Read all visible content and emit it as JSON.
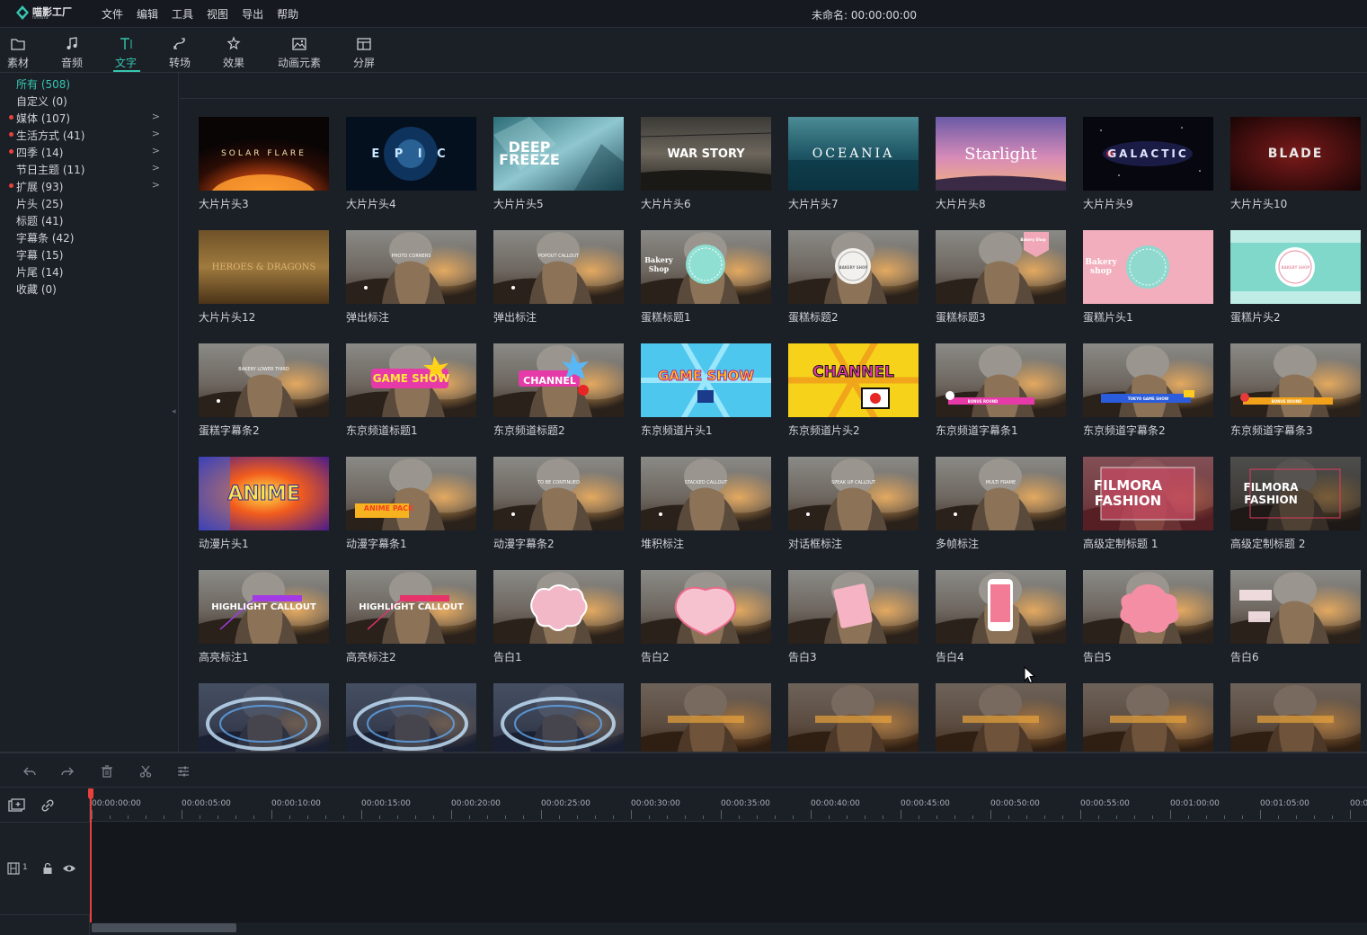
{
  "app": {
    "logo_name": "喵影工厂",
    "logo_sub": "filmora",
    "menu": [
      "文件",
      "编辑",
      "工具",
      "视图",
      "导出",
      "帮助"
    ],
    "project_title": "未命名: 00:00:00:00"
  },
  "tabs": [
    {
      "label": "素材",
      "icon": "folder-icon"
    },
    {
      "label": "音频",
      "icon": "music-note-icon"
    },
    {
      "label": "文字",
      "icon": "text-icon",
      "active": true
    },
    {
      "label": "转场",
      "icon": "transition-icon"
    },
    {
      "label": "效果",
      "icon": "effects-icon"
    },
    {
      "label": "动画元素",
      "icon": "image-icon"
    },
    {
      "label": "分屏",
      "icon": "split-screen-icon"
    }
  ],
  "categories": [
    {
      "label": "所有 (508)",
      "active": true,
      "dot": false,
      "arrow": false
    },
    {
      "label": "自定义 (0)",
      "dot": false,
      "arrow": false
    },
    {
      "label": "媒体 (107)",
      "dot": true,
      "arrow": true
    },
    {
      "label": "生活方式 (41)",
      "dot": true,
      "arrow": true
    },
    {
      "label": "四季 (14)",
      "dot": true,
      "arrow": true
    },
    {
      "label": "节日主题 (11)",
      "dot": false,
      "arrow": true
    },
    {
      "label": "扩展 (93)",
      "dot": true,
      "arrow": true
    },
    {
      "label": "片头 (25)",
      "dot": false,
      "arrow": false
    },
    {
      "label": "标题 (41)",
      "dot": false,
      "arrow": false
    },
    {
      "label": "字幕条 (42)",
      "dot": false,
      "arrow": false
    },
    {
      "label": "字幕 (15)",
      "dot": false,
      "arrow": false
    },
    {
      "label": "片尾 (14)",
      "dot": false,
      "arrow": false
    },
    {
      "label": "收藏 (0)",
      "dot": false,
      "arrow": false
    }
  ],
  "colors": {
    "accent": "#36c6b1",
    "dot": "#e8413c",
    "playhead": "#e8413c"
  },
  "items": [
    {
      "label": "大片片头3",
      "thumb_text": "SOLAR FLARE",
      "style": "solar"
    },
    {
      "label": "大片片头4",
      "thumb_text": "E P I C",
      "style": "epic"
    },
    {
      "label": "大片片头5",
      "thumb_text": "DEEP FREEZE",
      "style": "freeze"
    },
    {
      "label": "大片片头6",
      "thumb_text": "WAR STORY",
      "style": "war"
    },
    {
      "label": "大片片头7",
      "thumb_text": "OCEANIA",
      "style": "ocean"
    },
    {
      "label": "大片片头8",
      "thumb_text": "Starlight",
      "style": "star"
    },
    {
      "label": "大片片头9",
      "thumb_text": "GALACTIC",
      "style": "galactic"
    },
    {
      "label": "大片片头10",
      "thumb_text": "BLADE",
      "style": "blade"
    },
    {
      "label": "大片片头12",
      "thumb_text": "HEROES & DRAGONS",
      "style": "heroes"
    },
    {
      "label": "弹出标注",
      "thumb_text": "PHOTO CORNERS",
      "style": "photo"
    },
    {
      "label": "弹出标注",
      "thumb_text": "POPOUT CALLOUT",
      "style": "photo"
    },
    {
      "label": "蛋糕标题1",
      "thumb_text": "Bakery Shop",
      "style": "bakery-teal"
    },
    {
      "label": "蛋糕标题2",
      "thumb_text": "BAKERY SHOP",
      "style": "bakery-white"
    },
    {
      "label": "蛋糕标题3",
      "thumb_text": "Bakery Shop",
      "style": "bakery-tag"
    },
    {
      "label": "蛋糕片头1",
      "thumb_text": "Bakery shop",
      "style": "bakery-pink"
    },
    {
      "label": "蛋糕片头2",
      "thumb_text": "BAKERY SHOP",
      "style": "bakery-mint"
    },
    {
      "label": "蛋糕字幕条2",
      "thumb_text": "BAKERY LOWER THIRD",
      "style": "photo"
    },
    {
      "label": "东京频道标题1",
      "thumb_text": "GAME SHOW",
      "style": "game-photo"
    },
    {
      "label": "东京频道标题2",
      "thumb_text": "CHANNEL",
      "style": "channel-photo"
    },
    {
      "label": "东京频道片头1",
      "thumb_text": "GAME SHOW",
      "style": "game-blue"
    },
    {
      "label": "东京频道片头2",
      "thumb_text": "CHANNEL",
      "style": "channel-yellow"
    },
    {
      "label": "东京频道字幕条1",
      "thumb_text": "BONUS ROUND",
      "style": "lower-pink"
    },
    {
      "label": "东京频道字幕条2",
      "thumb_text": "TOKYO GAME SHOW",
      "style": "lower-blue"
    },
    {
      "label": "东京频道字幕条3",
      "thumb_text": "BONUS ROUND",
      "style": "lower-orange"
    },
    {
      "label": "动漫片头1",
      "thumb_text": "ANIME",
      "style": "anime"
    },
    {
      "label": "动漫字幕条1",
      "thumb_text": "ANIME PACK",
      "style": "anime-photo"
    },
    {
      "label": "动漫字幕条2",
      "thumb_text": "TO BE CONTINUED",
      "style": "photo"
    },
    {
      "label": "堆积标注",
      "thumb_text": "STACKED CALLOUT",
      "style": "photo"
    },
    {
      "label": "对话框标注",
      "thumb_text": "SPEAK UP CALLOUT",
      "style": "photo"
    },
    {
      "label": "多帧标注",
      "thumb_text": "MULTI FRAME",
      "style": "photo"
    },
    {
      "label": "高级定制标题 1",
      "thumb_text": "FILMORA FASHION",
      "style": "fashion-red"
    },
    {
      "label": "高级定制标题 2",
      "thumb_text": "FILMORA FASHION",
      "style": "fashion-dark"
    },
    {
      "label": "高亮标注1",
      "thumb_text": "HIGHLIGHT CALLOUT",
      "style": "hl-purple"
    },
    {
      "label": "高亮标注2",
      "thumb_text": "HIGHLIGHT CALLOUT",
      "style": "hl-red"
    },
    {
      "label": "告白1",
      "thumb_text": "",
      "style": "love1"
    },
    {
      "label": "告白2",
      "thumb_text": "",
      "style": "love2"
    },
    {
      "label": "告白3",
      "thumb_text": "",
      "style": "love3"
    },
    {
      "label": "告白4",
      "thumb_text": "",
      "style": "love4"
    },
    {
      "label": "告白5",
      "thumb_text": "",
      "style": "love5"
    },
    {
      "label": "告白6",
      "thumb_text": "",
      "style": "love6"
    },
    {
      "label": "",
      "thumb_text": "",
      "style": "swirl"
    },
    {
      "label": "",
      "thumb_text": "",
      "style": "swirl"
    },
    {
      "label": "",
      "thumb_text": "",
      "style": "swirl"
    },
    {
      "label": "",
      "thumb_text": "",
      "style": "gold"
    },
    {
      "label": "",
      "thumb_text": "",
      "style": "gold"
    },
    {
      "label": "",
      "thumb_text": "",
      "style": "gold"
    },
    {
      "label": "",
      "thumb_text": "",
      "style": "gold"
    },
    {
      "label": "",
      "thumb_text": "",
      "style": "gold"
    }
  ],
  "edit_tools": [
    "undo-icon",
    "redo-icon",
    "delete-icon",
    "cut-icon",
    "adjust-icon"
  ],
  "timeline": {
    "ticks": [
      "00:00:00:00",
      "00:00:05:00",
      "00:00:10:00",
      "00:00:15:00",
      "00:00:20:00",
      "00:00:25:00",
      "00:00:30:00",
      "00:00:35:00",
      "00:00:40:00",
      "00:00:45:00",
      "00:00:50:00",
      "00:00:55:00",
      "00:01:00:00",
      "00:01:05:00",
      "00:0"
    ],
    "track_number": "1"
  }
}
